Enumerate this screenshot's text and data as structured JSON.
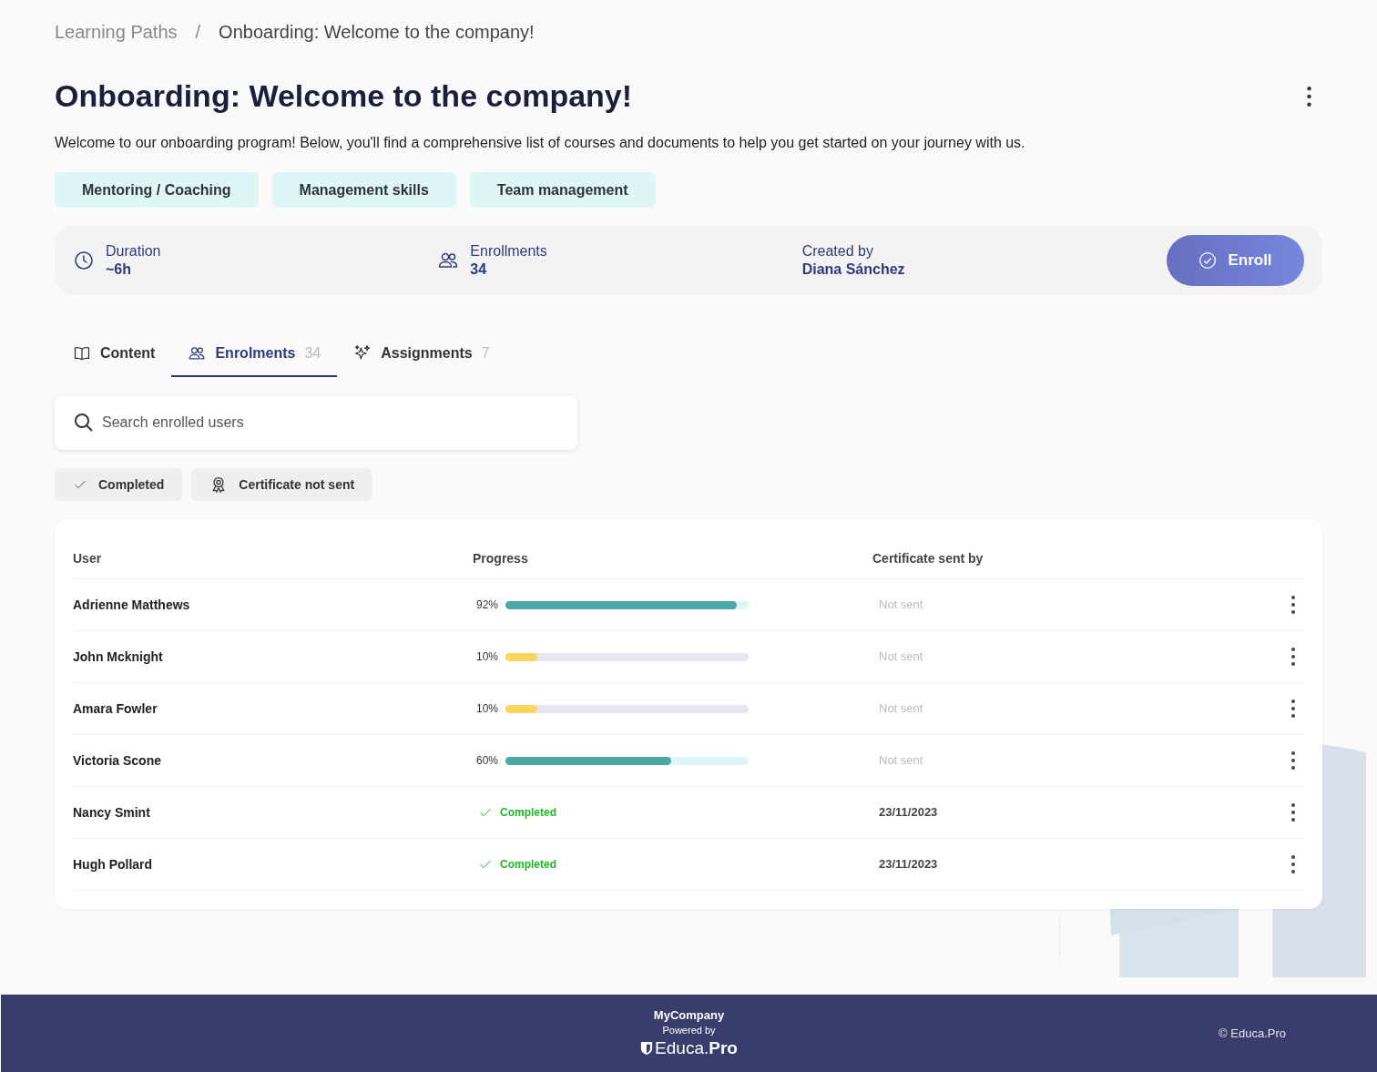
{
  "breadcrumb": [
    "Learning Paths",
    "/",
    "Onboarding: Welcome to the company!"
  ],
  "title": "Onboarding: Welcome to the company!",
  "description": "Welcome to our onboarding program! Below, you'll find a comprehensive list of courses and documents to help you get started on your journey with us.",
  "tags": [
    "Mentoring / Coaching",
    "Management skills",
    "Team management"
  ],
  "info": [
    {
      "kind": "duration",
      "label": "Duration",
      "value": "~6h"
    },
    {
      "kind": "enrollments",
      "label": "Enrollments",
      "value": "34"
    },
    {
      "kind": "creator",
      "label": "Created by",
      "value": "Diana Sánchez"
    }
  ],
  "enroll_button": "Enroll",
  "tabs": [
    {
      "kind": "content",
      "label": "Content",
      "selected": false
    },
    {
      "kind": "enrolments",
      "label": "Enrolments",
      "count": "34",
      "selected": true
    },
    {
      "kind": "assignments",
      "label": "Assignments",
      "count": "7",
      "selected": false
    }
  ],
  "search": {
    "placeholder": "Search enrolled users"
  },
  "filters": [
    {
      "kind": "completed",
      "label": "Completed"
    },
    {
      "kind": "certificate",
      "label": "Certificate not sent"
    }
  ],
  "table": {
    "columns": [
      "User",
      "Progress",
      "Certificate sent by"
    ],
    "rows": [
      {
        "user": "Adrienne Matthews",
        "kind": "progress",
        "reading": "92%",
        "level": 0.95,
        "color": "#4aa9a4",
        "certificate": "Not sent",
        "sent": false
      },
      {
        "user": "John Mcknight",
        "kind": "progress",
        "reading": "10%",
        "level": 0.13,
        "color": "#fcd55f",
        "certificate": "Not sent",
        "sent": false
      },
      {
        "user": "Amara Fowler",
        "kind": "progress",
        "reading": "10%",
        "level": 0.13,
        "color": "#fcd55f",
        "certificate": "Not sent",
        "sent": false
      },
      {
        "user": "Victoria Scone",
        "kind": "progress",
        "reading": "60%",
        "level": 0.68,
        "color": "#4aa9a4",
        "certificate": "Not sent",
        "sent": false
      },
      {
        "user": "Nancy Smint",
        "kind": "completed",
        "status": "Completed",
        "certificate": "23/11/2023",
        "sent": true
      },
      {
        "user": "Hugh Pollard",
        "kind": "completed",
        "status": "Completed",
        "certificate": "23/11/2023",
        "sent": true
      }
    ]
  },
  "footer": {
    "company": "MyCompany",
    "powered_by": "Powered by",
    "logo": "Educa.**Pro**",
    "copyright": "© Educa.Pro"
  }
}
